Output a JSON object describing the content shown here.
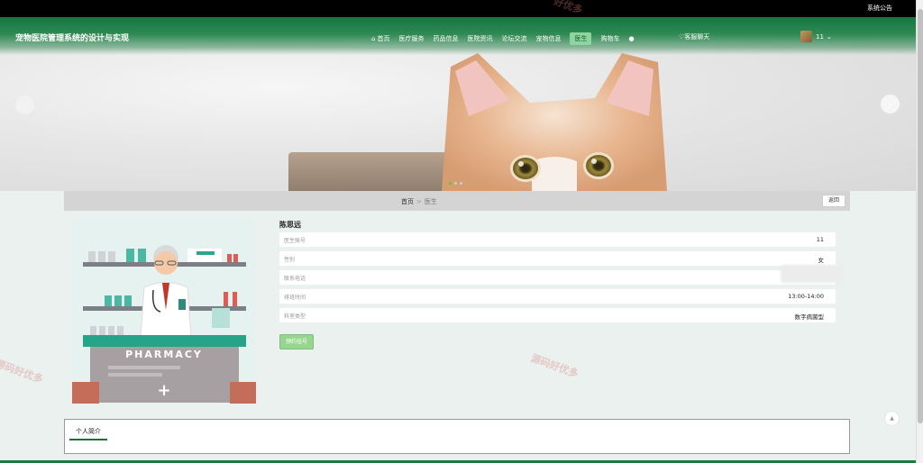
{
  "topbar": {
    "notice": "系统公告"
  },
  "header": {
    "site_title": "宠物医院管理系统的设计与实现",
    "nav": [
      {
        "label": "首页",
        "icon": "home-icon"
      },
      {
        "label": "医疗服务"
      },
      {
        "label": "药品信息"
      },
      {
        "label": "医院资讯"
      },
      {
        "label": "论坛交流"
      },
      {
        "label": "宠物信息"
      },
      {
        "label": "医生",
        "active": true
      },
      {
        "label": "购物车"
      }
    ],
    "customer_service": "♡客服聊天",
    "user_name": "11"
  },
  "banner": {
    "slides": 3,
    "active_slide": 1
  },
  "breadcrumb": {
    "home": "首页",
    "separator": ">",
    "current": "医生",
    "back_label": "返回"
  },
  "doctor": {
    "name": "陈思远",
    "fields": [
      {
        "key": "doctor_account",
        "label": "医生账号",
        "value": "11"
      },
      {
        "key": "gender",
        "label": "性别",
        "value": "女"
      },
      {
        "key": "phone",
        "label": "联系电话",
        "value": ""
      },
      {
        "key": "shift_time",
        "label": "排班时间",
        "value": "13:00-14:00"
      },
      {
        "key": "department",
        "label": "科室类型",
        "value": "数字病菌型"
      }
    ],
    "book_label": "预约挂号",
    "image_sign": "PHARMACY"
  },
  "intro": {
    "tab_label": "个人简介"
  },
  "watermarks": [
    "源码好优多",
    "源码好优多",
    "好优多"
  ],
  "colors": {
    "primary": "#1d7a3e",
    "active_nav": "#8fd49e",
    "book_button": "#98d590"
  }
}
